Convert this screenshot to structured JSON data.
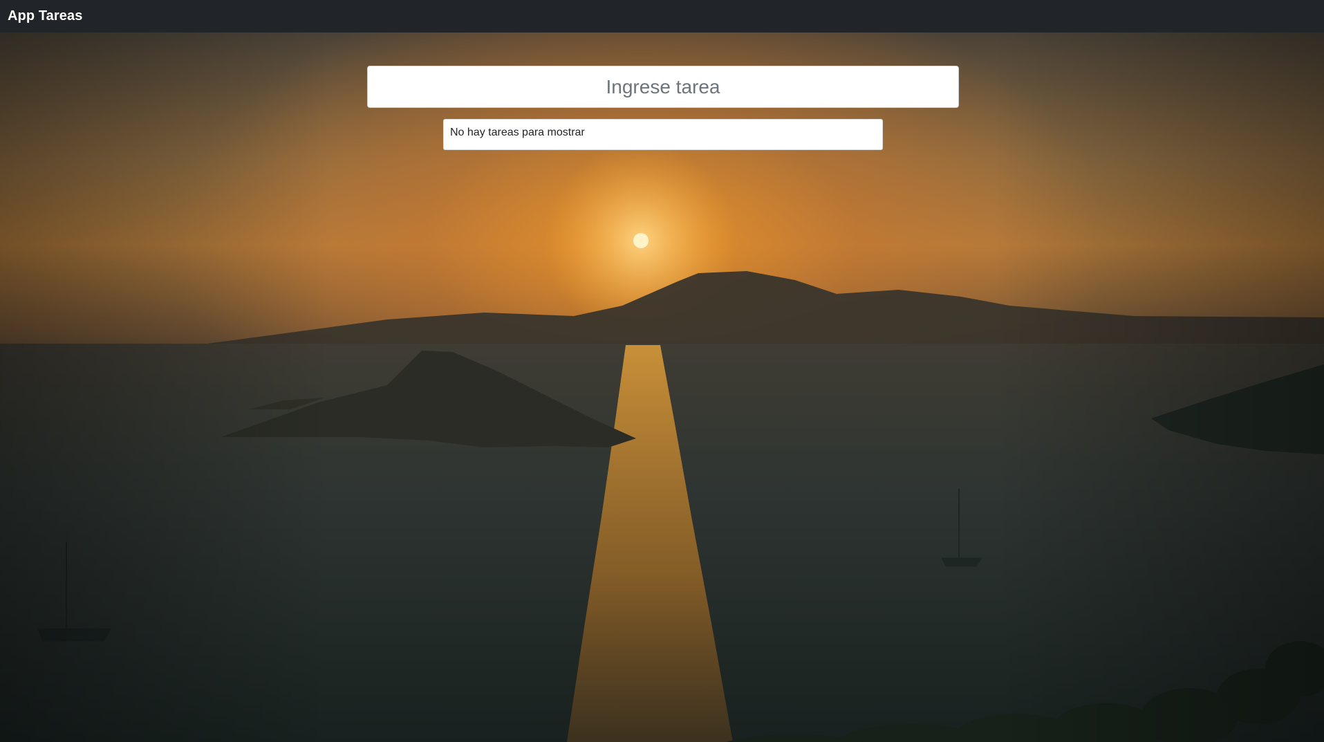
{
  "navbar": {
    "brand": "App Tareas"
  },
  "task_input": {
    "placeholder": "Ingrese tarea",
    "value": ""
  },
  "task_list": {
    "empty_message": "No hay tareas para mostrar",
    "items": []
  },
  "colors": {
    "navbar_bg": "#212529",
    "sun": "#fff3c8",
    "sun_glow": "#f3a22c"
  }
}
